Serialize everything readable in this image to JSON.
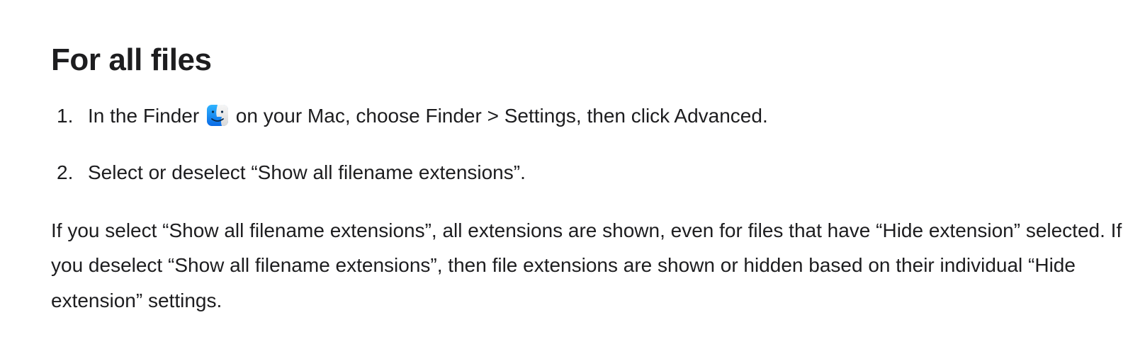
{
  "section": {
    "heading": "For all files",
    "steps": [
      {
        "pre": "In the Finder ",
        "icon": "finder-icon",
        "post": " on your Mac, choose Finder > Settings, then click Advanced."
      },
      {
        "pre": "Select or deselect “Show all filename extensions”.",
        "icon": null,
        "post": ""
      }
    ],
    "paragraph": "If you select “Show all filename extensions”, all extensions are shown, even for files that have “Hide extension” selected. If you deselect “Show all filename extensions”, then file extensions are shown or hidden based on their individual “Hide extension” settings."
  }
}
